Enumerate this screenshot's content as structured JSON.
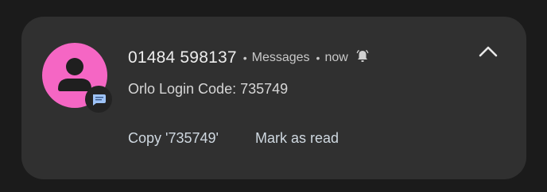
{
  "notification": {
    "sender": "01484 598137",
    "separator": "•",
    "app_name": "Messages",
    "time": "now",
    "message": "Orlo Login Code: 735749",
    "icons": {
      "avatar": "person-icon",
      "app_badge": "messages-bubble-icon",
      "bell": "bell-alert-icon",
      "collapse": "chevron-up-icon"
    },
    "colors": {
      "avatar_bg": "#f566c4",
      "card_bg": "#303030",
      "badge_bubble": "#9ec3f7"
    }
  },
  "actions": {
    "copy_label": "Copy '735749'",
    "mark_read_label": "Mark as read"
  }
}
